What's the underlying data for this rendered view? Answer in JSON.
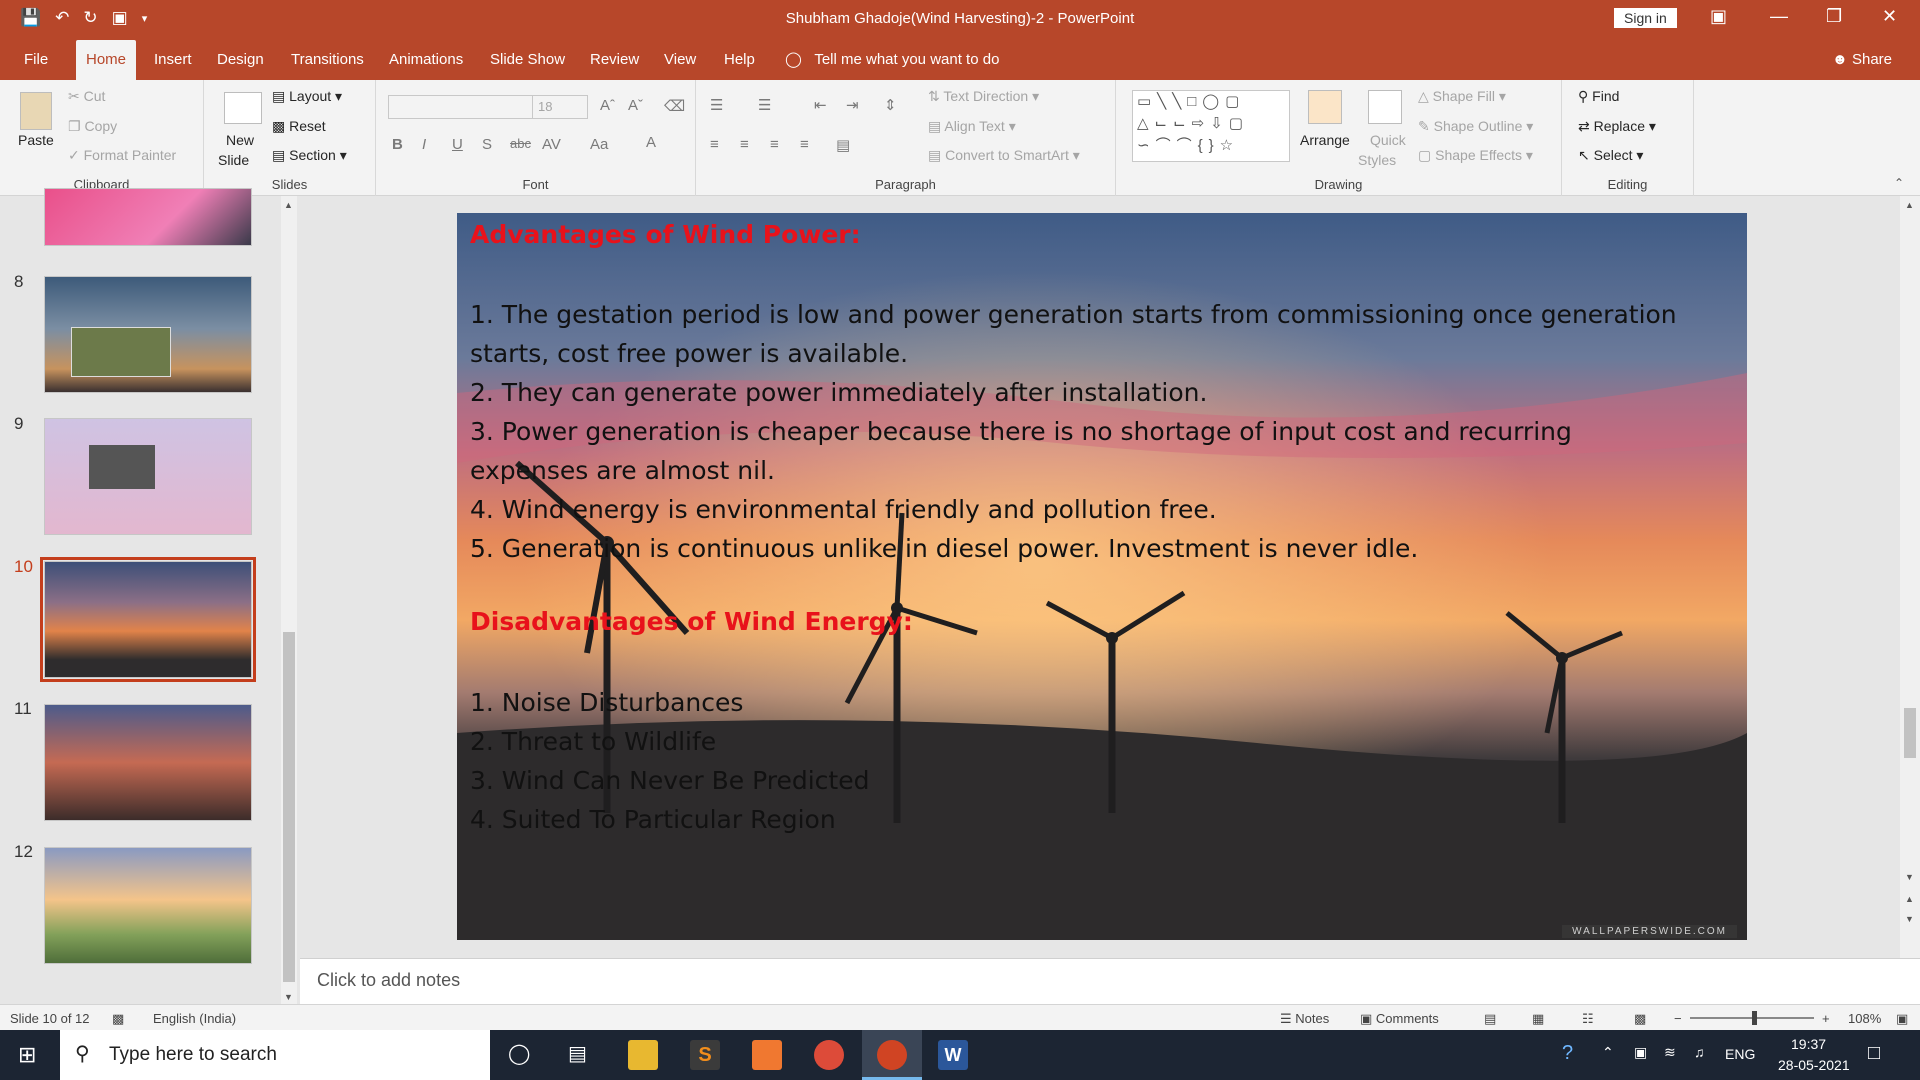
{
  "window": {
    "title": "Shubham Ghadoje(Wind Harvesting)-2  -  PowerPoint",
    "sign_in": "Sign in"
  },
  "tabs": [
    "File",
    "Home",
    "Insert",
    "Design",
    "Transitions",
    "Animations",
    "Slide Show",
    "Review",
    "View",
    "Help"
  ],
  "active_tab": "Home",
  "tell_me": "Tell me what you want to do",
  "share": "Share",
  "ribbon": {
    "clipboard": {
      "paste": "Paste",
      "cut": "Cut",
      "copy": "Copy",
      "format_painter": "Format Painter",
      "label": "Clipboard"
    },
    "slides": {
      "new_slide_1": "New",
      "new_slide_2": "Slide",
      "layout": "Layout",
      "reset": "Reset",
      "section": "Section",
      "label": "Slides"
    },
    "font": {
      "font_size": "18",
      "label": "Font"
    },
    "paragraph": {
      "text_direction": "Text Direction",
      "align_text": "Align Text",
      "convert_smartart": "Convert to SmartArt",
      "label": "Paragraph"
    },
    "drawing": {
      "arrange": "Arrange",
      "quick_styles_1": "Quick",
      "quick_styles_2": "Styles",
      "shape_fill": "Shape Fill",
      "shape_outline": "Shape Outline",
      "shape_effects": "Shape Effects",
      "label": "Drawing"
    },
    "editing": {
      "find": "Find",
      "replace": "Replace",
      "select": "Select",
      "label": "Editing"
    }
  },
  "thumbnails": [
    {
      "num": "8"
    },
    {
      "num": "9"
    },
    {
      "num": "10"
    },
    {
      "num": "11"
    },
    {
      "num": "12"
    }
  ],
  "slide": {
    "heading_adv": "Advantages of Wind Power:",
    "adv_lines": [
      "1. The gestation period is low and power generation starts from commissioning once generation",
      "starts, cost free power is available.",
      "2. They can generate power immediately after installation.",
      "3. Power generation is cheaper because there is no shortage of input cost and recurring",
      "expenses are almost nil.",
      "4. Wind energy is environmental friendly and pollution free.",
      "5. Generation is continuous unlike in diesel power. Investment is never idle."
    ],
    "heading_dis": "Disadvantages of Wind Energy:",
    "dis_lines": [
      "1. Noise Disturbances",
      "2. Threat to Wildlife",
      "3. Wind Can Never Be Predicted",
      "4. Suited To Particular Region"
    ],
    "watermark": "WALLPAPERSWIDE.COM"
  },
  "notes_placeholder": "Click to add notes",
  "status": {
    "slide_of": "Slide 10 of 12",
    "language": "English (India)",
    "notes": "Notes",
    "comments": "Comments",
    "zoom": "108%"
  },
  "taskbar": {
    "search_placeholder": "Type here to search",
    "lang": "ENG",
    "time": "19:37",
    "date": "28-05-2021"
  }
}
